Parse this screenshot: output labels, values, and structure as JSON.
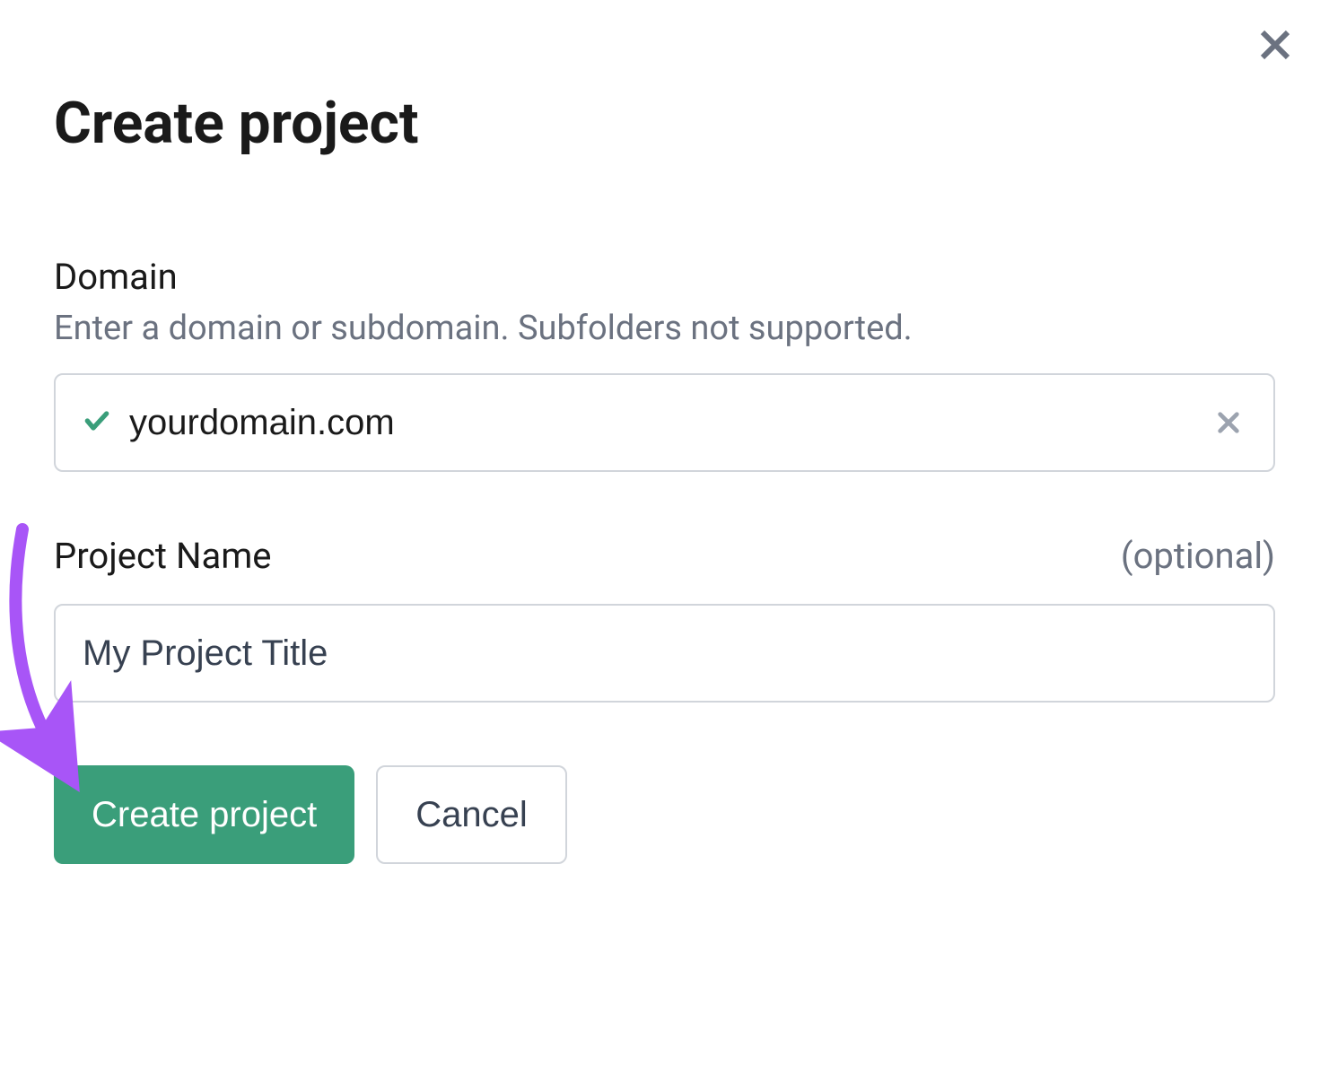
{
  "modal": {
    "title": "Create project",
    "close_aria": "Close"
  },
  "domain": {
    "label": "Domain",
    "help": "Enter a domain or subdomain. Subfolders not supported.",
    "value": "yourdomain.com",
    "validated": true
  },
  "project_name": {
    "label": "Project Name",
    "optional_text": "(optional)",
    "placeholder": "My Project Title",
    "value": ""
  },
  "buttons": {
    "create": "Create project",
    "cancel": "Cancel"
  },
  "colors": {
    "primary": "#3a9e7a",
    "annotation": "#a855f7"
  }
}
